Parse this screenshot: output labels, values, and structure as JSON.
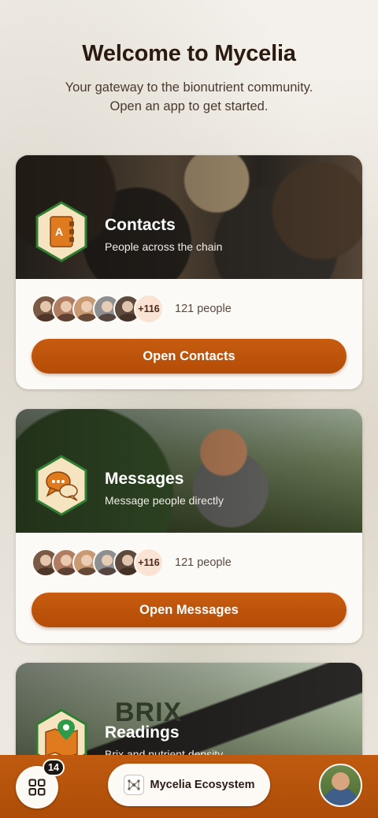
{
  "header": {
    "title": "Welcome to Mycelia",
    "subtitle_line1": "Your gateway to the bionutrient community.",
    "subtitle_line2": "Open an app to get started."
  },
  "cards": [
    {
      "title": "Contacts",
      "subtitle": "People across the chain",
      "icon": "address-book-icon",
      "more_count": "+116",
      "people_count": "121 people",
      "button_label": "Open Contacts",
      "avatar_colors": [
        "#7a5a44",
        "#b07c62",
        "#c89a74",
        "#8f8f92",
        "#5d4a3c"
      ]
    },
    {
      "title": "Messages",
      "subtitle": "Message people directly",
      "icon": "chat-bubbles-icon",
      "more_count": "+116",
      "people_count": "121 people",
      "button_label": "Open Messages",
      "avatar_colors": [
        "#7a5a44",
        "#b07c62",
        "#c89a74",
        "#8f8f92",
        "#5d4a3c"
      ]
    },
    {
      "title": "Readings",
      "subtitle": "Brix and nutrient density",
      "hero_text": "BRIX",
      "icon": "map-pin-icon"
    }
  ],
  "bottom_bar": {
    "apps_badge": "14",
    "ecosystem_label": "Mycelia Ecosystem"
  },
  "colors": {
    "accent": "#c05a10",
    "icon_hex_border": "#2e7d32",
    "icon_hex_fill": "#f6e3bf",
    "icon_orange": "#e07a1f"
  }
}
